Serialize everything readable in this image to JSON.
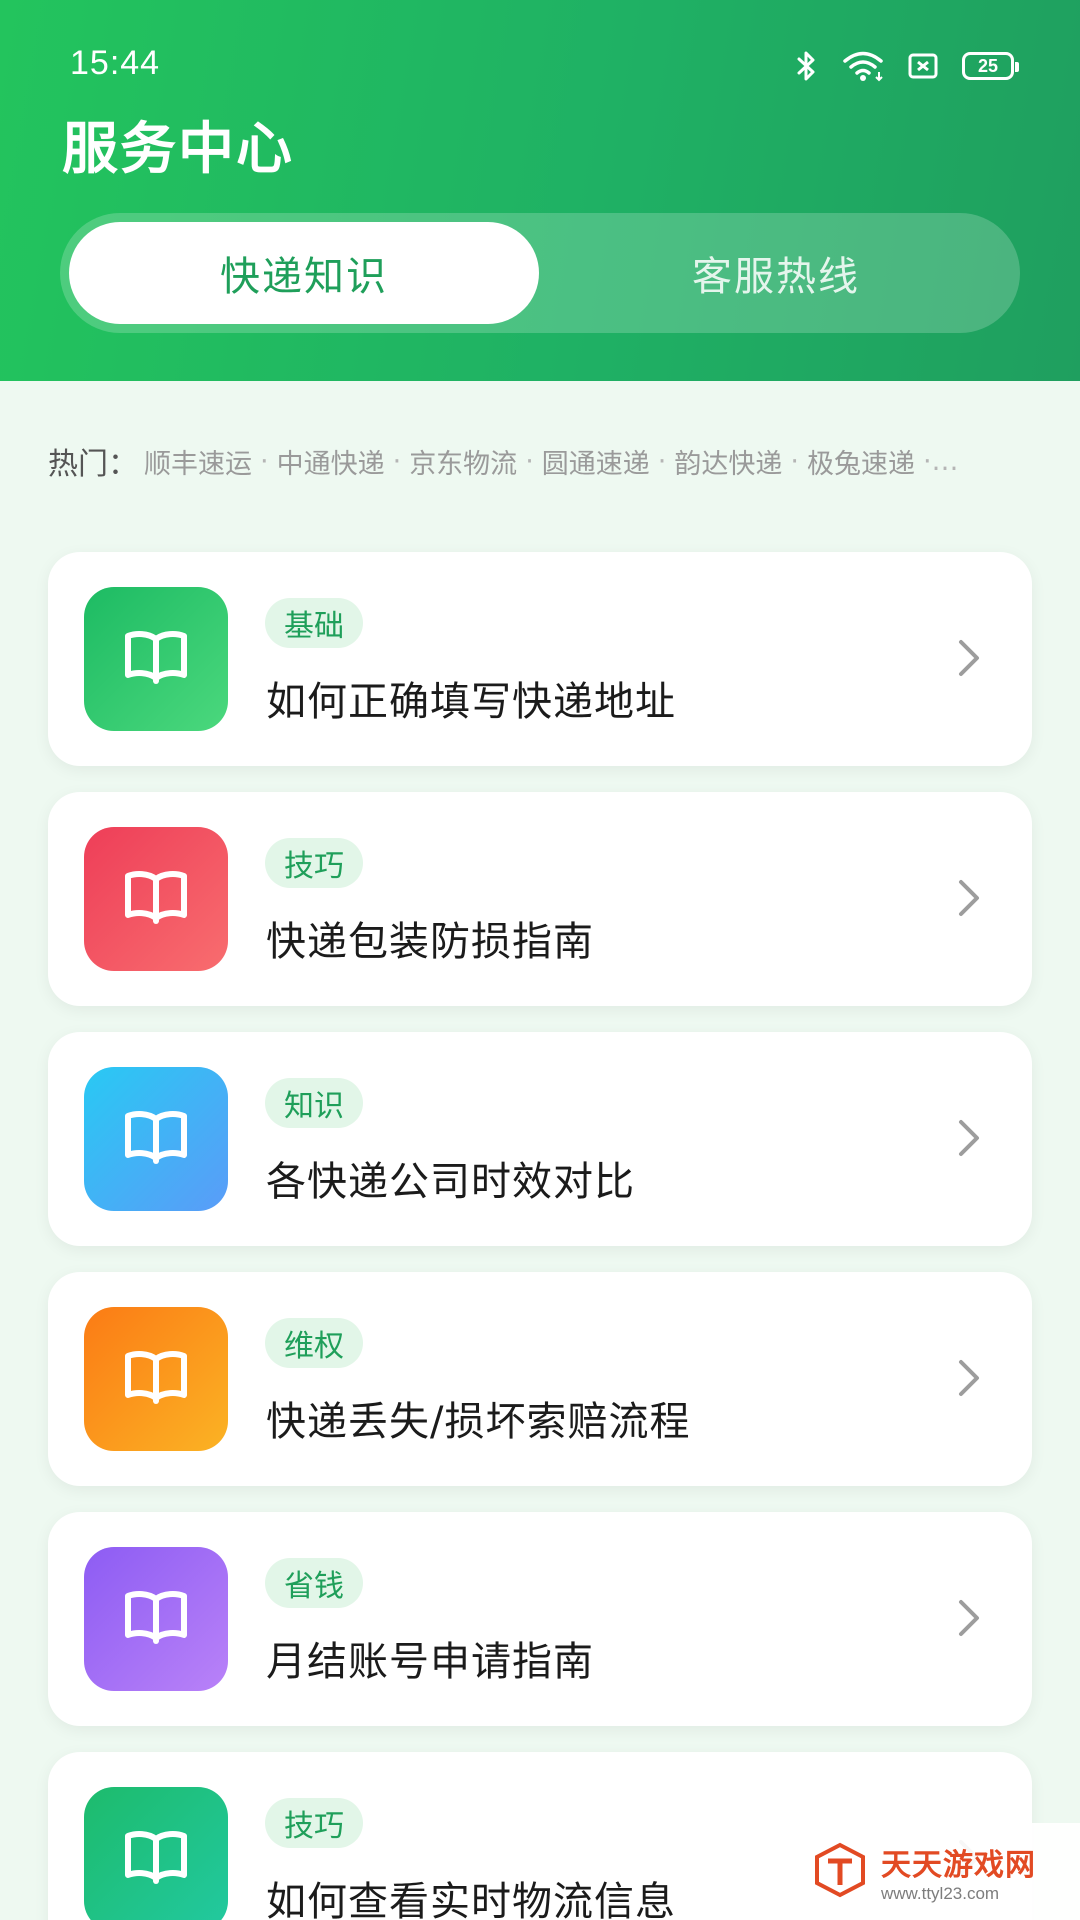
{
  "status_bar": {
    "time": "15:44",
    "battery": "25",
    "icons": [
      "bluetooth-icon",
      "wifi-icon",
      "sim-card-icon",
      "battery-icon"
    ]
  },
  "header": {
    "title": "服务中心",
    "tabs": [
      {
        "label": "快递知识",
        "active": true
      },
      {
        "label": "客服热线",
        "active": false
      }
    ]
  },
  "hot": {
    "label": "热门：",
    "items": [
      "顺丰速运",
      "中通快递",
      "京东物流",
      "圆通速递",
      "韵达快递",
      "极兔速递"
    ],
    "separator": "·",
    "more": "·…"
  },
  "articles": [
    {
      "tag": "基础",
      "title": "如何正确填写快递地址",
      "icon": "book-icon",
      "color_from": "#1dbb63",
      "color_to": "#4bd87d"
    },
    {
      "tag": "技巧",
      "title": "快递包装防损指南",
      "icon": "book-icon",
      "color_from": "#ee3e58",
      "color_to": "#f86d6f"
    },
    {
      "tag": "知识",
      "title": "各快递公司时效对比",
      "icon": "book-icon",
      "color_from": "#29c9f3",
      "color_to": "#5a9cf8"
    },
    {
      "tag": "维权",
      "title": "快递丢失/损坏索赔流程",
      "icon": "book-icon",
      "color_from": "#fb7b15",
      "color_to": "#fbb324"
    },
    {
      "tag": "省钱",
      "title": "月结账号申请指南",
      "icon": "book-icon",
      "color_from": "#8d5cf3",
      "color_to": "#b982f8"
    },
    {
      "tag": "技巧",
      "title": "如何查看实时物流信息",
      "icon": "book-icon",
      "color_from": "#1dbb6c",
      "color_to": "#22c9a0"
    }
  ],
  "watermark": {
    "cn": "天天游戏网",
    "url": "www.ttyl23.com"
  },
  "colors": {
    "brand": "#1fb164",
    "tag_bg": "#e2f6e8",
    "tag_text": "#1f9f5a",
    "page_bg": "#eef9f1"
  }
}
